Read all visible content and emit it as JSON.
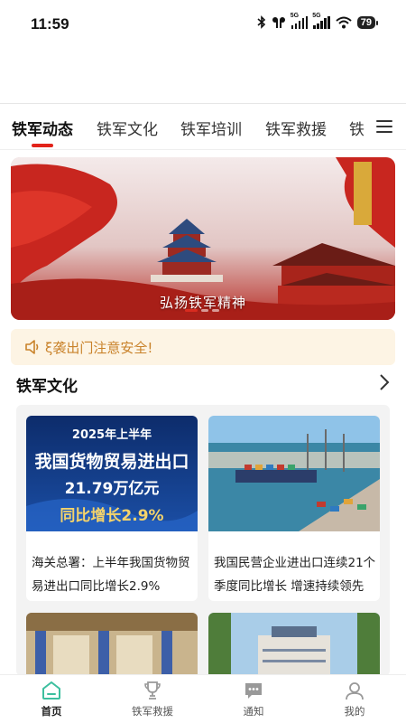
{
  "status_bar": {
    "time": "11:59",
    "battery": "79",
    "network_1": "5G",
    "network_2": "5G"
  },
  "tabs": [
    {
      "label": "铁军动态",
      "active": true
    },
    {
      "label": "铁军文化",
      "active": false
    },
    {
      "label": "铁军培训",
      "active": false
    },
    {
      "label": "铁军救援",
      "active": false
    },
    {
      "label": "铁",
      "active": false
    }
  ],
  "banner": {
    "caption": "弘扬铁军精神"
  },
  "notice": {
    "icon": "speaker-icon",
    "text": "ξ袭出门注意安全!"
  },
  "section": {
    "title": "铁军文化",
    "more_icon": "chevron-right-icon"
  },
  "cards": [
    {
      "title": "海关总署：上半年我国货物贸易进出口同比增长2.9%",
      "image_text": {
        "line1": "2025年上半年",
        "line2": "我国货物贸易进出口",
        "line3": "21.79万亿元",
        "line4": "同比增长2.9%"
      }
    },
    {
      "title": "我国民营企业进出口连续21个季度同比增长 增速持续领先"
    },
    {
      "title": ""
    },
    {
      "title": ""
    }
  ],
  "bottom_nav": [
    {
      "label": "首页",
      "icon": "home-icon",
      "active": true
    },
    {
      "label": "铁军救援",
      "icon": "trophy-icon",
      "active": false
    },
    {
      "label": "通知",
      "icon": "message-icon",
      "active": false
    },
    {
      "label": "我的",
      "icon": "user-icon",
      "active": false
    }
  ],
  "colors": {
    "accent": "#e2231a",
    "nav_active": "#3dbf9f",
    "notice_bg": "#fdf4e4",
    "notice_text": "#c9822a"
  }
}
